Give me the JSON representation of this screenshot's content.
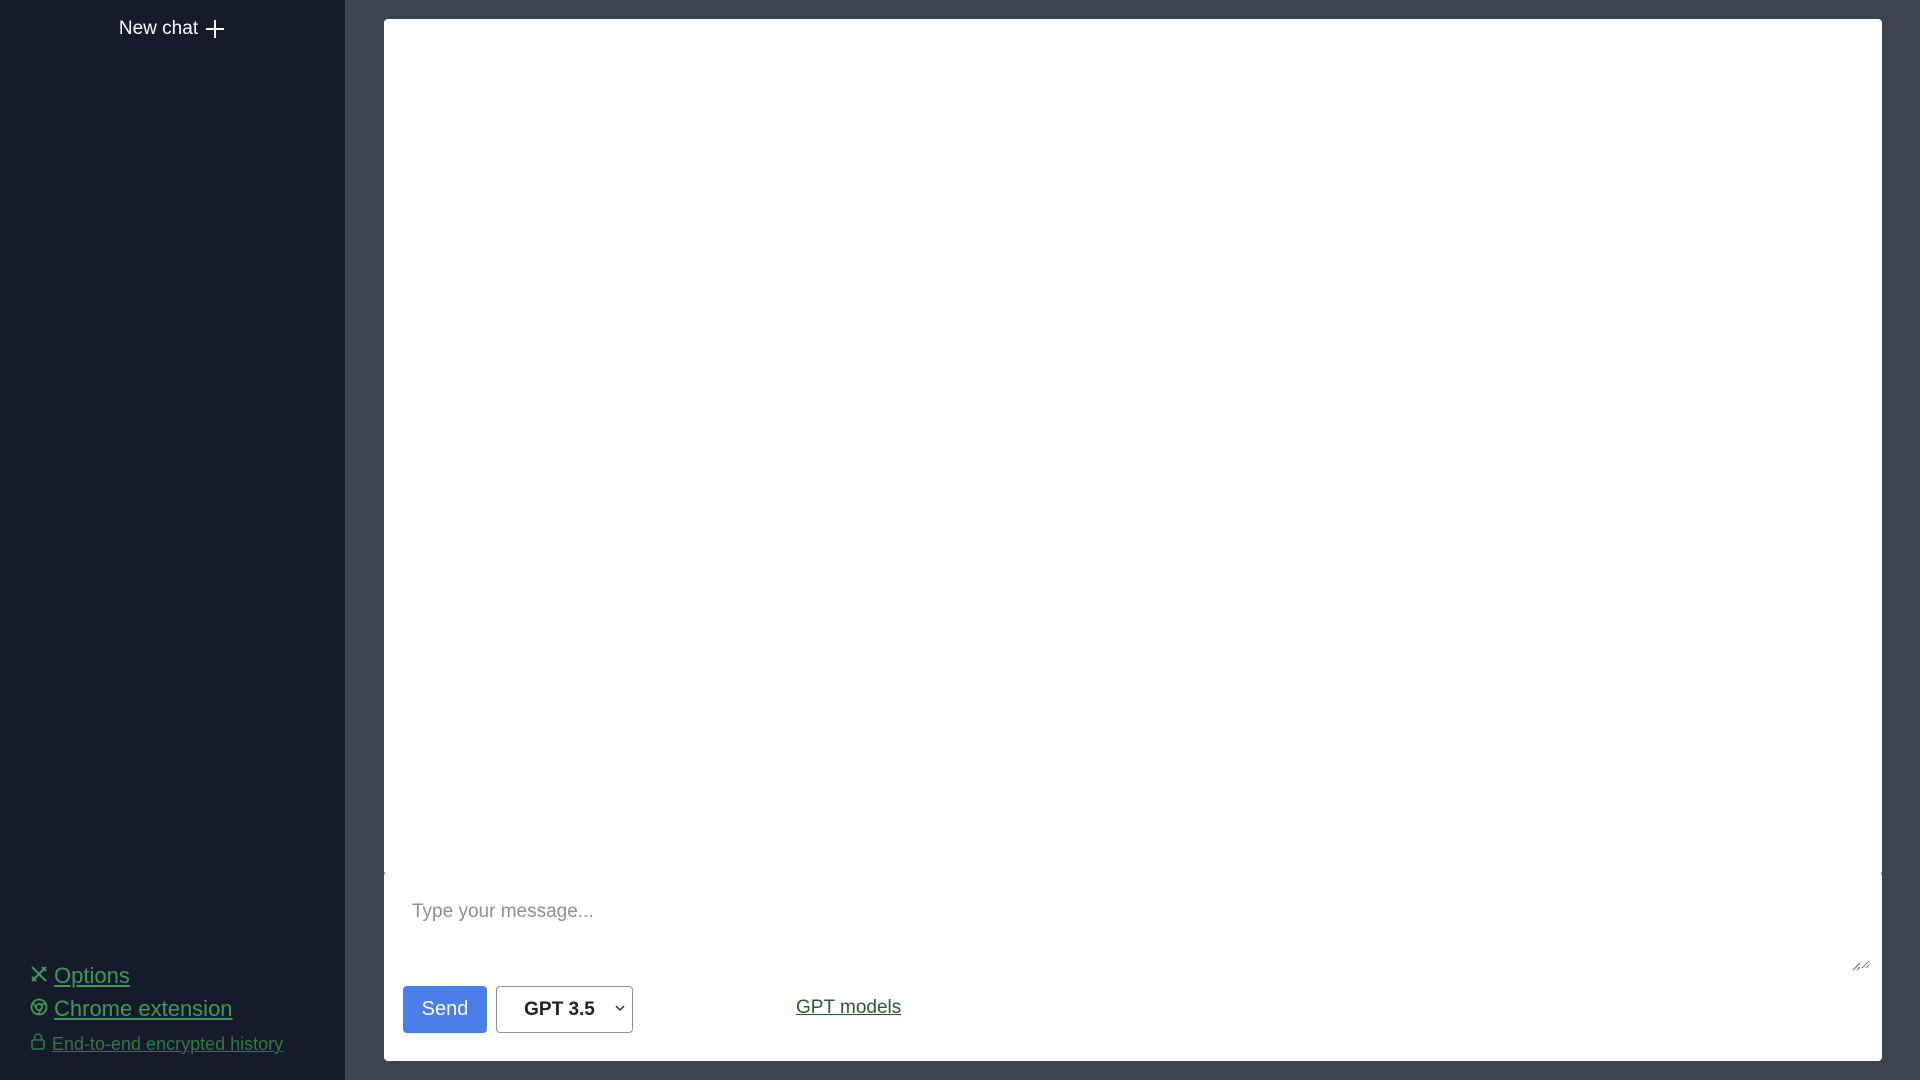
{
  "sidebar": {
    "new_chat_label": "New chat",
    "links": [
      {
        "label": " Options",
        "icon": "tools-icon"
      },
      {
        "label": " Chrome extension",
        "icon": "chrome-icon"
      },
      {
        "label": " End-to-end encrypted history",
        "icon": "lock-icon"
      }
    ]
  },
  "composer": {
    "placeholder": "Type your message...",
    "value": "",
    "send_label": "Send",
    "model_selected": "GPT 3.5",
    "models_link_label": "GPT models"
  },
  "colors": {
    "sidebar_bg": "#151b2a",
    "page_bg": "#3e4350",
    "accent_blue": "#4a7ee8",
    "link_green": "#3f9a56"
  }
}
